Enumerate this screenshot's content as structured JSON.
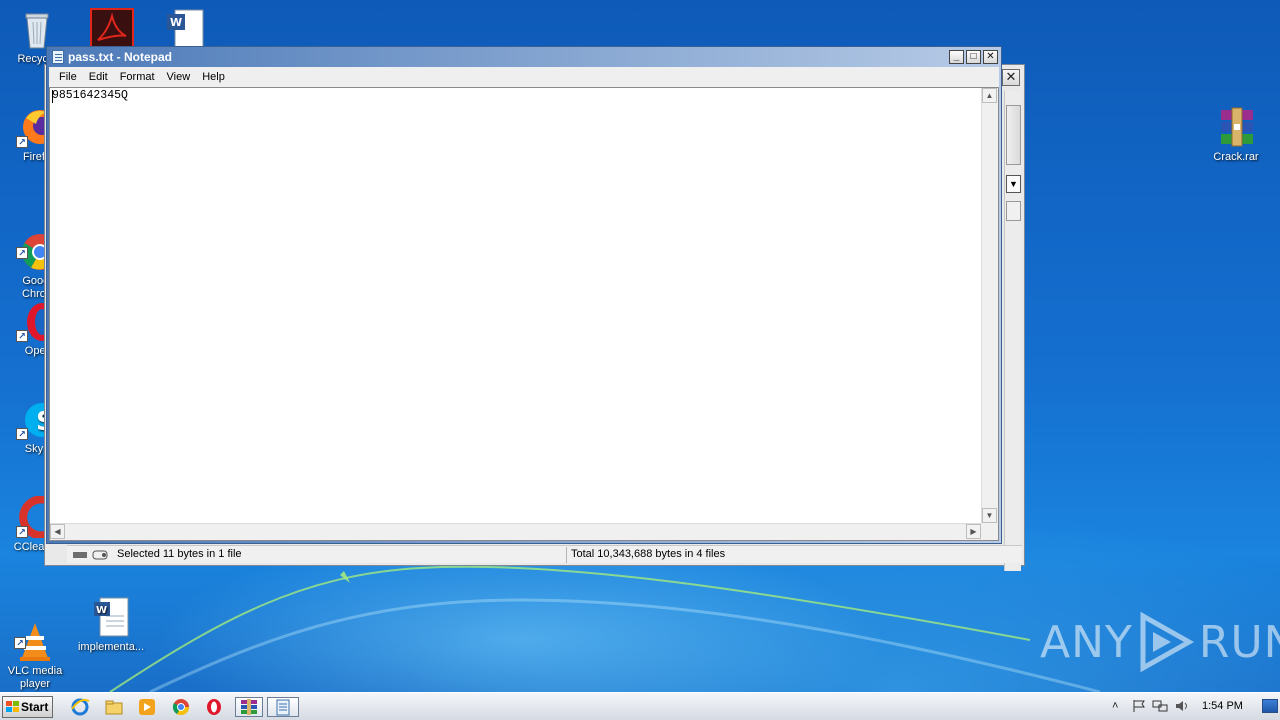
{
  "desktop": {
    "icons": [
      {
        "label": "Recycle",
        "icon": "recycle-bin-icon"
      },
      {
        "label": "Firefo",
        "icon": "firefox-icon"
      },
      {
        "label": "Googl\nChron",
        "icon": "chrome-icon"
      },
      {
        "label": "Oper",
        "icon": "opera-icon"
      },
      {
        "label": "Skyp",
        "icon": "skype-icon"
      },
      {
        "label": "CCleaner",
        "icon": "ccleaner-icon"
      },
      {
        "label": "VLC media\nplayer",
        "icon": "vlc-icon"
      },
      {
        "label": "implementa...",
        "icon": "word-document-icon"
      },
      {
        "label": "Crack.rar",
        "icon": "winrar-archive-icon"
      }
    ],
    "top_icons": [
      "acrobat-icon",
      "word-document-icon"
    ]
  },
  "notepad": {
    "title": "pass.txt - Notepad",
    "menu": [
      "File",
      "Edit",
      "Format",
      "View",
      "Help"
    ],
    "content": "9851642345Q",
    "controls": {
      "minimize": "_",
      "maximize": "□",
      "close": "✕"
    }
  },
  "back_window": {
    "close": "✕",
    "status_left": "Selected 11 bytes in 1 file",
    "status_right": "Total 10,343,688 bytes in 4 files"
  },
  "watermark": {
    "left": "ANY",
    "right": "RUN"
  },
  "taskbar": {
    "start_label": "Start",
    "pinned": [
      "internet-explorer-icon",
      "explorer-folder-icon",
      "media-player-icon",
      "chrome-icon",
      "opera-icon",
      "winrar-icon",
      "notepad-icon"
    ],
    "clock": "1:54 PM"
  }
}
